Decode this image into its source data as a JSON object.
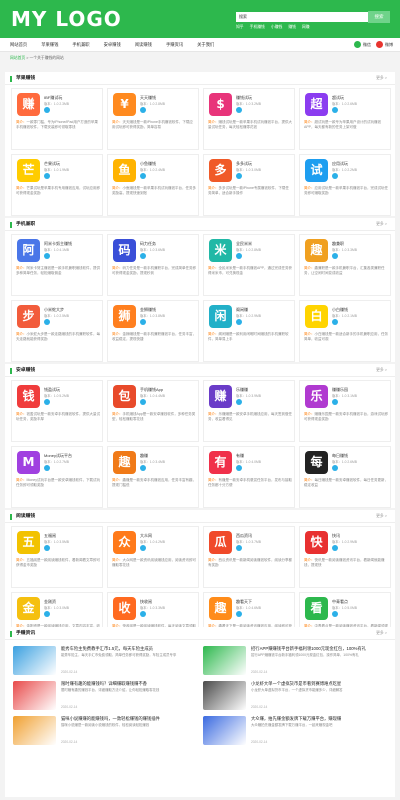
{
  "header": {
    "logo": "MY LOGO",
    "search_value": "搜索",
    "search_button": "搜索",
    "hot_keywords": [
      "知乎",
      "手机赚钱",
      "小赚钱",
      "赚钱",
      "网赚"
    ]
  },
  "nav": {
    "items": [
      "网站首页",
      "苹果赚钱",
      "手机兼职",
      "安卓赚钱",
      "阅读赚钱",
      "手赚资讯",
      "关于我们"
    ],
    "weixin": "微信",
    "weibo": "微博"
  },
  "breadcrumb": {
    "home": "网站首页",
    "sep": " > ",
    "current": "一个关于赚钱的网站"
  },
  "sections": [
    {
      "title": "苹果赚钱",
      "more": "更多 >",
      "apps": [
        {
          "name": "IBF赚试玩",
          "meta": "版本：1.0  2.3MB",
          "desc": "一款零门槛、专为iPhone/iPad用户打造的苹果手机赚钱软件，下载安装即可领取零钱",
          "icon": "赚",
          "color": "#ff6a3d"
        },
        {
          "name": "天天赚钱",
          "meta": "版本：1.0  2.8MB",
          "desc": "天天赚钱是一款iPhone手机赚钱软件，下载应用试玩即可获得奖励，简单容易",
          "icon": "¥",
          "color": "#ff8a1f"
        },
        {
          "name": "赚钱试玩",
          "meta": "版本：1.0  3.2MB",
          "desc": "赚钱试玩是一款苹果手机试玩赚钱平台，提供大量试玩任务，每天轻松赚零花钱",
          "icon": "$",
          "color": "#e8347a"
        },
        {
          "name": "超试玩",
          "meta": "版本：1.0  2.6MB",
          "desc": "超试玩是一款专为苹果用户设计的试玩赚钱APP，每天都有新的任务上架可做",
          "icon": "超",
          "color": "#8b3cf0"
        },
        {
          "name": "芒果试玩",
          "meta": "版本：1.0  1.9MB",
          "desc": "芒果试玩是苹果手机专用赚钱应用，试玩应用即可获得现金奖励",
          "icon": "芒",
          "color": "#ffcc00"
        },
        {
          "name": "小鱼赚钱",
          "meta": "版本：1.0  2.4MB",
          "desc": "小鱼赚钱是一款苹果手机试玩赚钱平台，任务多奖励高，提现快速到账",
          "icon": "鱼",
          "color": "#ffb300"
        },
        {
          "name": "多多试玩",
          "meta": "版本：1.0  3.0MB",
          "desc": "多多试玩是一款iPhone专属赚钱软件，下载任务简单，适合新手操作",
          "icon": "多",
          "color": "#f05a28"
        },
        {
          "name": "应用试玩",
          "meta": "版本：1.0  2.2MB",
          "desc": "应用试玩是一款苹果手机赚钱平台，完成试玩任务即可赚取奖励",
          "icon": "试",
          "color": "#1e9ef0"
        }
      ]
    },
    {
      "title": "手机兼职",
      "more": "更多 >",
      "apps": [
        {
          "name": "阿米卡努主赚钱",
          "meta": "版本：1.0  4.1MB",
          "desc": "阿米卡努主赚钱是一款手机兼职赚钱软件，提供多种简单任务，轻松赚取佣金",
          "icon": "阿",
          "color": "#4a76e8"
        },
        {
          "name": "码力任务",
          "meta": "版本：1.0  3.6MB",
          "desc": "码力任务是一款手机兼职平台，完成简单任务即可获得现金奖励，提现秒到",
          "icon": "码",
          "color": "#3a4fd8"
        },
        {
          "name": "全民米米",
          "meta": "版本：1.0  2.8MB",
          "desc": "全民米米是一款手机赚钱APP，通过完成任务获得米米币，可兑换现金",
          "icon": "米",
          "color": "#21b8a6"
        },
        {
          "name": "趣兼职",
          "meta": "版本：1.0  3.3MB",
          "desc": "趣兼职是一款手机兼职平台，汇集各类兼职任务，让空闲时间变成收益",
          "icon": "趣",
          "color": "#f0a020"
        },
        {
          "name": "小米蛇大步",
          "meta": "版本：1.0  2.5MB",
          "desc": "小米蛇大步是一款走路赚钱的手机兼职软件，每天走路就能获得奖励",
          "icon": "步",
          "color": "#f25c3c"
        },
        {
          "name": "金狮赚钱",
          "meta": "版本：1.0  3.8MB",
          "desc": "金狮赚钱是一款手机兼职赚钱平台，任务丰富，收益稳定，提现快捷",
          "icon": "狮",
          "color": "#ff7f1f"
        },
        {
          "name": "阁闲赚",
          "meta": "版本：1.0  2.9MB",
          "desc": "阁闲赚是一款利用闲暇时间赚钱的手机兼职软件，简单易上手",
          "icon": "闲",
          "color": "#22b0c8"
        },
        {
          "name": "小白赚钱",
          "meta": "版本：1.0  2.1MB",
          "desc": "小白赚钱是一款适合新手的手机兼职应用，任务简单，收益可观",
          "icon": "白",
          "color": "#ffd400"
        }
      ]
    },
    {
      "title": "安卓赚钱",
      "more": "更多 >",
      "apps": [
        {
          "name": "钱盈试玩",
          "meta": "版本：1.0  5.2MB",
          "desc": "钱盈试玩是一款安卓手机赚钱软件，提供大量试玩任务，奖励丰厚",
          "icon": "钱",
          "color": "#f03c3c"
        },
        {
          "name": "手机赚钱App",
          "meta": "版本：1.0  4.4MB",
          "desc": "手机赚钱App是一款安卓赚钱软件，多种任务类型，轻松赚取零花钱",
          "icon": "包",
          "color": "#e84a2a"
        },
        {
          "name": "乐赚赚",
          "meta": "版本：1.0  3.9MB",
          "desc": "乐赚赚是一款安卓手机赚钱应用，每天签到做任务，收益看得见",
          "icon": "赚",
          "color": "#6a3cc8"
        },
        {
          "name": "赚赚乐园",
          "meta": "版本：1.0  3.1MB",
          "desc": "赚赚乐园是一款安卓手机赚钱平台，游戏试玩即可获得现金奖励",
          "icon": "乐",
          "color": "#b03ad0"
        },
        {
          "name": "Money试玩平台",
          "meta": "版本：1.0  2.7MB",
          "desc": "Money试玩平台是一款安卓赚钱软件，下载试玩任务即可领取奖励",
          "icon": "M",
          "color": "#a040e0"
        },
        {
          "name": "趣赚",
          "meta": "版本：1.0  3.4MB",
          "desc": "趣赚是一款安卓手机赚钱应用，任务丰富有趣，提现门槛低",
          "icon": "趣",
          "color": "#f07a18"
        },
        {
          "name": "有赚",
          "meta": "版本：1.0  4.0MB",
          "desc": "有赚是一款安卓手机悬赏任务平台，发布与接取任务都十分方便",
          "icon": "有",
          "color": "#f0304a"
        },
        {
          "name": "每日赚钱",
          "meta": "版本：1.0  2.6MB",
          "desc": "每日赚钱是一款安卓赚钱软件，每日任务更新，稳定收益",
          "icon": "每",
          "color": "#222222"
        }
      ]
    },
    {
      "title": "阅读赚钱",
      "more": "更多 >",
      "apps": [
        {
          "name": "五福阅",
          "meta": "版本：1.0  3.5MB",
          "desc": "五福阅是一款阅读赚钱软件，看新闻看文章即可获得金币奖励",
          "icon": "五",
          "color": "#f2c200"
        },
        {
          "name": "大众网",
          "meta": "版本：1.0  4.2MB",
          "desc": "大众网是一款资讯阅读赚钱应用，阅读资讯即可赚取零花钱",
          "icon": "众",
          "color": "#ff7a1a"
        },
        {
          "name": "西瓜资讯",
          "meta": "版本：1.0  3.7MB",
          "desc": "西瓜资讯是一款新闻阅读赚钱软件，阅读分享都有奖励",
          "icon": "瓜",
          "color": "#f04a2a"
        },
        {
          "name": "快讯",
          "meta": "版本：1.0  2.9MB",
          "desc": "快讯是一款阅读赚钱资讯平台，看新闻就能赚钱，提现快",
          "icon": "快",
          "color": "#e83030"
        },
        {
          "name": "金刚资",
          "meta": "版本：1.0  3.0MB",
          "desc": "金刚资是一款阅读赚钱应用，文章内容丰富，收益稳定",
          "icon": "金",
          "color": "#f5c010"
        },
        {
          "name": "快收阅",
          "meta": "版本：1.0  3.3MB",
          "desc": "快收阅是一款阅读赚钱软件，每天阅读文章领取金币",
          "icon": "收",
          "color": "#ff6a20"
        },
        {
          "name": "趣看天下",
          "meta": "版本：1.0  4.6MB",
          "desc": "趣看天下是一款阅读资讯赚钱应用，阅读即可获得收益",
          "icon": "趣",
          "color": "#ff8c1a"
        },
        {
          "name": "中青看点",
          "meta": "版本：1.0  5.0MB",
          "desc": "中青看点是一款阅读赚钱资讯平台，看新闻领现金奖励",
          "icon": "看",
          "color": "#2db84d"
        }
      ]
    }
  ],
  "news": {
    "title": "手赚资讯",
    "more": "更多 >",
    "items": [
      {
        "title": "能秀车险主免费教手汇币1.5元，每天车险主成员",
        "desc": "能秀车险主，每天手汇币免费领取，简单任务即可获得奖励，车险主成员专享",
        "date": "2020-02-14",
        "color": "#3aa0e0"
      },
      {
        "title": "招行APP赚赚钱平台新手福利领1000元现金红包，100%有礼",
        "desc": "招行APP赚赚钱平台新手福利领1000元现金红包，操作简单，100%有礼",
        "date": "2020-02-14",
        "color": "#2db84d"
      },
      {
        "title": "限时赚有趣的能赚钱吗？详细赚取赚钱赚不香",
        "desc": "限时赚有趣的赚钱平台，详细赚取方法介绍，让你轻松赚取零花钱",
        "date": "2020-02-14",
        "color": "#e84a4a"
      },
      {
        "title": "小龙虾大单一个虚拟货币是币看到赛博难点吃星",
        "desc": "小龙虾大单虚拟货币平台，一个虚拟货币能赚多少，详细解答",
        "date": "2020-02-14",
        "color": "#4a4a4a"
      },
      {
        "title": "猫咪小说赚赚的能赚钱吗，一款轻松赚钱的赚钱插件",
        "desc": "猫咪小说赚是一款阅读小说赚钱的软件，轻松阅读轻松赚钱",
        "date": "2020-02-14",
        "color": "#f0a030"
      },
      {
        "title": "大众赚，拍先赚金额发牌下载万赚平台，赚现赚",
        "desc": "大众赚拍先赚金额发牌下载万赚平台，一起来赚现金吧",
        "date": "2020-02-14",
        "color": "#3a6ae0"
      }
    ]
  }
}
